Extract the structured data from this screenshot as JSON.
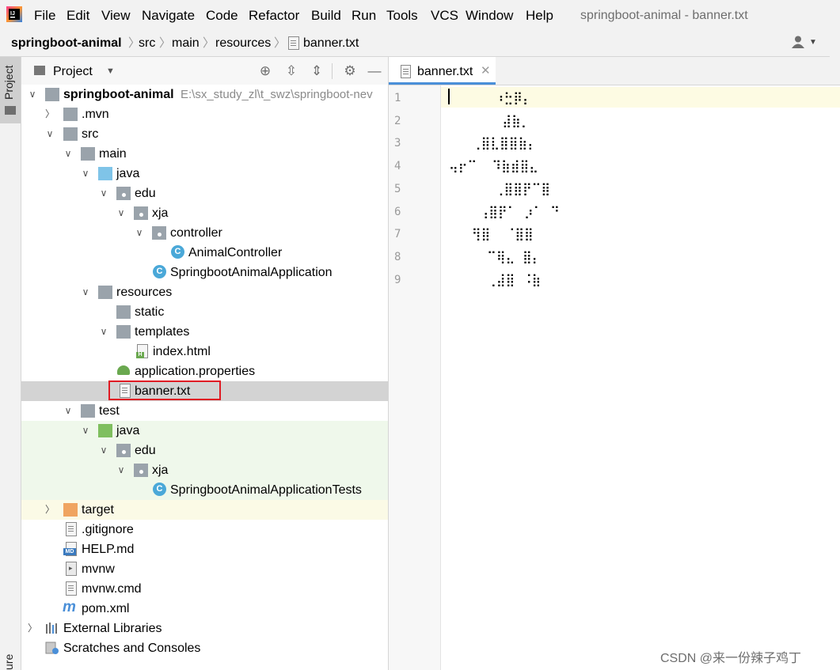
{
  "menu": [
    "File",
    "Edit",
    "View",
    "Navigate",
    "Code",
    "Refactor",
    "Build",
    "Run",
    "Tools",
    "VCS",
    "Window",
    "Help"
  ],
  "window_title": "springboot-animal - banner.txt",
  "breadcrumb": [
    "springboot-animal",
    "src",
    "main",
    "resources",
    "banner.txt"
  ],
  "tool_windows": {
    "project": "Project",
    "structure": "ure"
  },
  "panel": {
    "title": "Project"
  },
  "tree": {
    "root": {
      "label": "springboot-animal",
      "path": "E:\\sx_study_zl\\t_swz\\springboot-nev"
    },
    "mvn": ".mvn",
    "src": "src",
    "main": "main",
    "java": "java",
    "edu": "edu",
    "xja": "xja",
    "controller": "controller",
    "animal_controller": "AnimalController",
    "application_class": "SpringbootAnimalApplication",
    "resources": "resources",
    "static": "static",
    "templates": "templates",
    "index_html": "index.html",
    "application_properties": "application.properties",
    "banner": "banner.txt",
    "test": "test",
    "test_java": "java",
    "test_edu": "edu",
    "test_xja": "xja",
    "test_class": "SpringbootAnimalApplicationTests",
    "target": "target",
    "gitignore": ".gitignore",
    "help_md": "HELP.md",
    "mvnw": "mvnw",
    "mvnw_cmd": "mvnw.cmd",
    "pom": "pom.xml",
    "external_libraries": "External Libraries",
    "scratches": "Scratches and Consoles"
  },
  "editor": {
    "tab": "banner.txt",
    "line_numbers": [
      "1",
      "2",
      "3",
      "4",
      "5",
      "6",
      "7",
      "8",
      "9"
    ],
    "lines": [
      "      ⠰⣓⡿⡄",
      "       ⣼⣷⡀",
      "   ⢀⣿⣇⣿⣿⣷⡄",
      "⢤⡖⠉  ⠹⣷⣾⣿⣄",
      "      ⢀⣿⣿⡟⠉⣿",
      "    ⢠⣿⡟⠁ ⡰⠁ ⠙",
      "   ⢻⣿  ⠈⣿⣿",
      "     ⠉⢿⣄ ⣿⡄",
      "     ⢀⣼⣿ ⠨⣷"
    ]
  },
  "watermark": "CSDN @来一份辣子鸡丁"
}
